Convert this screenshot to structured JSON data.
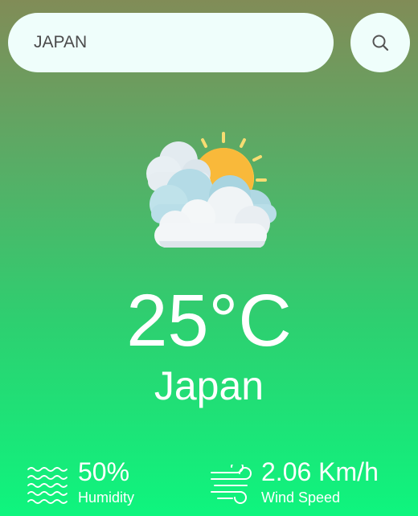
{
  "search": {
    "value": "JAPAN",
    "icon": "search-icon"
  },
  "weather": {
    "icon": "partly-cloudy-icon",
    "temperature": "25°C",
    "city": "Japan"
  },
  "stats": {
    "humidity": {
      "icon": "humidity-waves-icon",
      "value": "50%",
      "label": "Humidity"
    },
    "wind": {
      "icon": "wind-icon",
      "value": "2.06 Km/h",
      "label": "Wind Speed"
    }
  },
  "colors": {
    "gradient_top": "#818c57",
    "gradient_bottom": "#0ef57e",
    "search_background": "#effefb",
    "sun": "#f9b93a",
    "text": "#ffffff"
  }
}
